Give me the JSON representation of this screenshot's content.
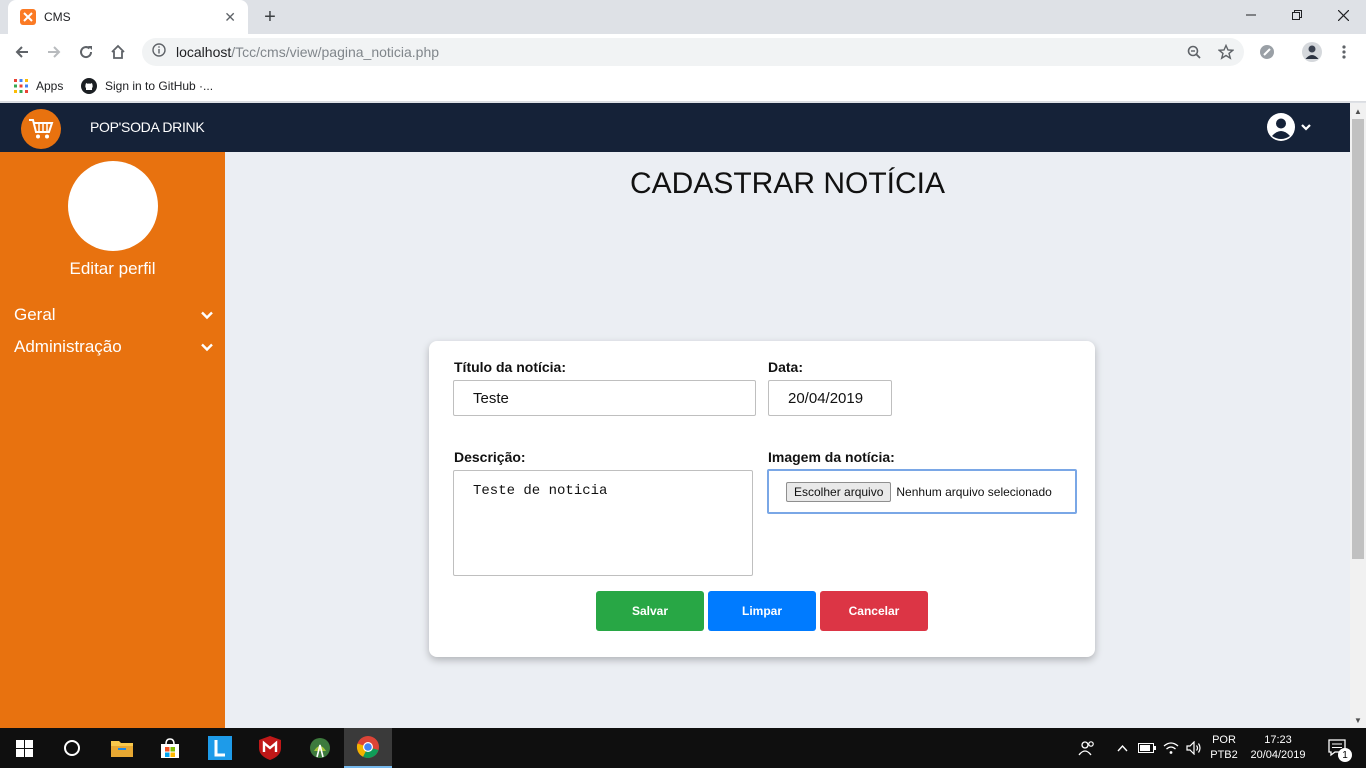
{
  "browser": {
    "tab_title": "CMS",
    "url_host": "localhost",
    "url_path": "/Tcc/cms/view/pagina_noticia.php",
    "bookmarks": [
      {
        "label": "Apps"
      },
      {
        "label": "Sign in to GitHub ·..."
      }
    ]
  },
  "app": {
    "brand": "POP'SODA DRINK",
    "sidebar": {
      "edit_profile": "Editar perfil",
      "items": [
        {
          "label": "Geral"
        },
        {
          "label": "Administração"
        }
      ]
    },
    "page_title": "CADASTRAR NOTÍCIA",
    "form": {
      "title_label": "Título da notícia:",
      "title_value": "Teste",
      "date_label": "Data:",
      "date_value": "20/04/2019",
      "description_label": "Descrição:",
      "description_value": "Teste de noticia",
      "image_label": "Imagem da notícia:",
      "file_button": "Escolher arquivo",
      "file_status": "Nenhum arquivo selecionado",
      "save": "Salvar",
      "clear": "Limpar",
      "cancel": "Cancelar"
    },
    "colors": {
      "topnav": "#152238",
      "sidebar": "#e8720f",
      "save": "#28a745",
      "clear": "#007bff",
      "cancel": "#dc3545"
    }
  },
  "taskbar": {
    "language_top": "POR",
    "language_bottom": "PTB2",
    "time": "17:23",
    "date": "20/04/2019",
    "notification_count": "1"
  }
}
